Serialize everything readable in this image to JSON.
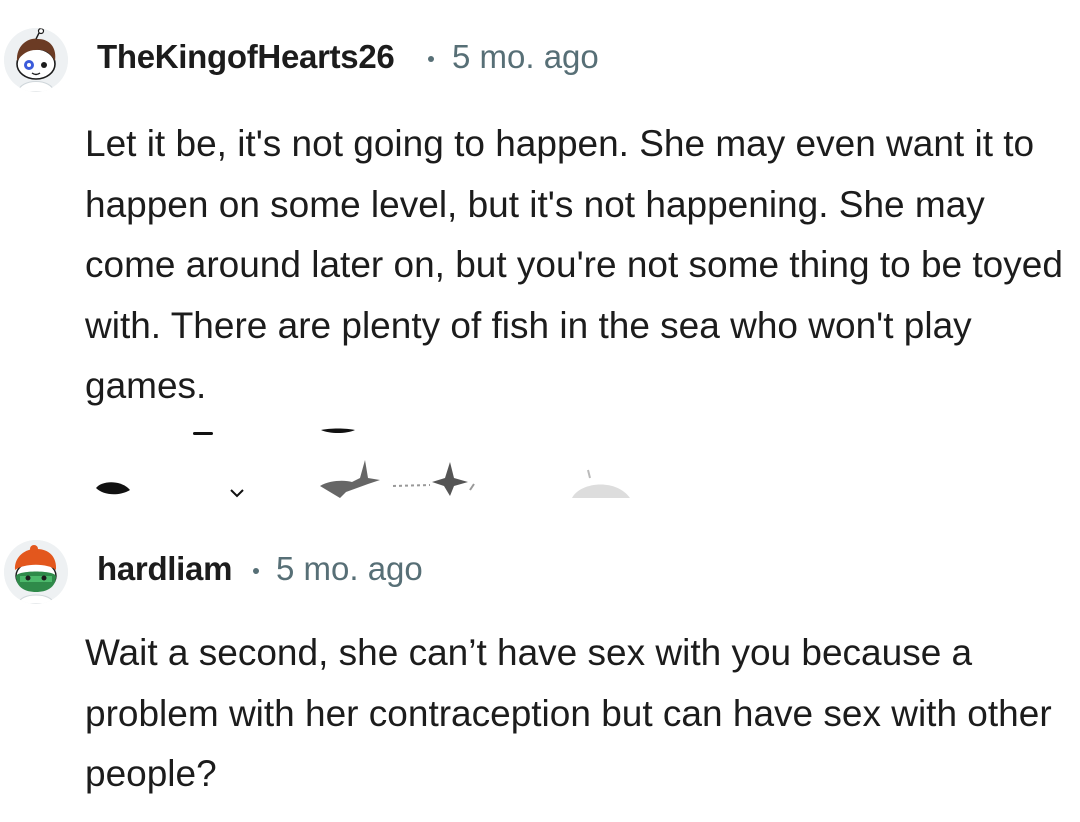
{
  "comments": [
    {
      "username": "TheKingofHearts26",
      "separator": "•",
      "timestamp": "5 mo. ago",
      "body": "Let it be, it's not going to happen. She may even want it to happen on some level, but it's not happening. She may come around later on, but you're not some thing to be toyed with. There are plenty of fish in the sea who won't play games.",
      "avatar_icon": "snoo-avatar-brown-hair-icon"
    },
    {
      "username": "hardliam",
      "separator": "•",
      "timestamp": "5 mo. ago",
      "body": "Wait a second, she can’t have sex with you because a problem with her contraception but can have sex with other people?",
      "avatar_icon": "snoo-avatar-orange-hat-green-mask-icon"
    }
  ],
  "action_bar": {
    "icons": [
      "upvote-icon",
      "downvote-icon",
      "award-icon",
      "share-icon",
      "reply-icon"
    ]
  },
  "colors": {
    "text": "#1c1c1c",
    "meta": "#576f76",
    "background": "#ffffff"
  }
}
